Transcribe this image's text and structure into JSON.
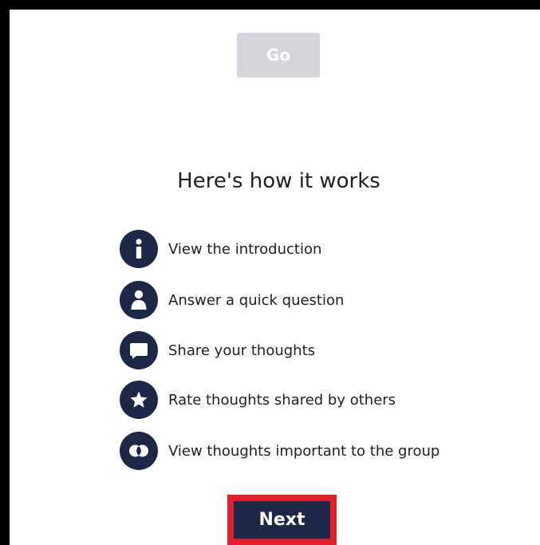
{
  "go_button": {
    "label": "Go"
  },
  "heading": "Here's how it works",
  "steps": [
    {
      "icon": "info-icon",
      "label": "View the introduction"
    },
    {
      "icon": "person-icon",
      "label": "Answer a quick question"
    },
    {
      "icon": "speech-bubble-icon",
      "label": "Share your thoughts"
    },
    {
      "icon": "star-icon",
      "label": "Rate thoughts shared by others"
    },
    {
      "icon": "venn-circles-icon",
      "label": "View thoughts important to the group"
    }
  ],
  "next_button": {
    "label": "Next"
  },
  "colors": {
    "navy": "#1d2747",
    "disabled_gray": "#d3d5da",
    "highlight_red": "#e31f2b",
    "frame_black": "#000000"
  }
}
